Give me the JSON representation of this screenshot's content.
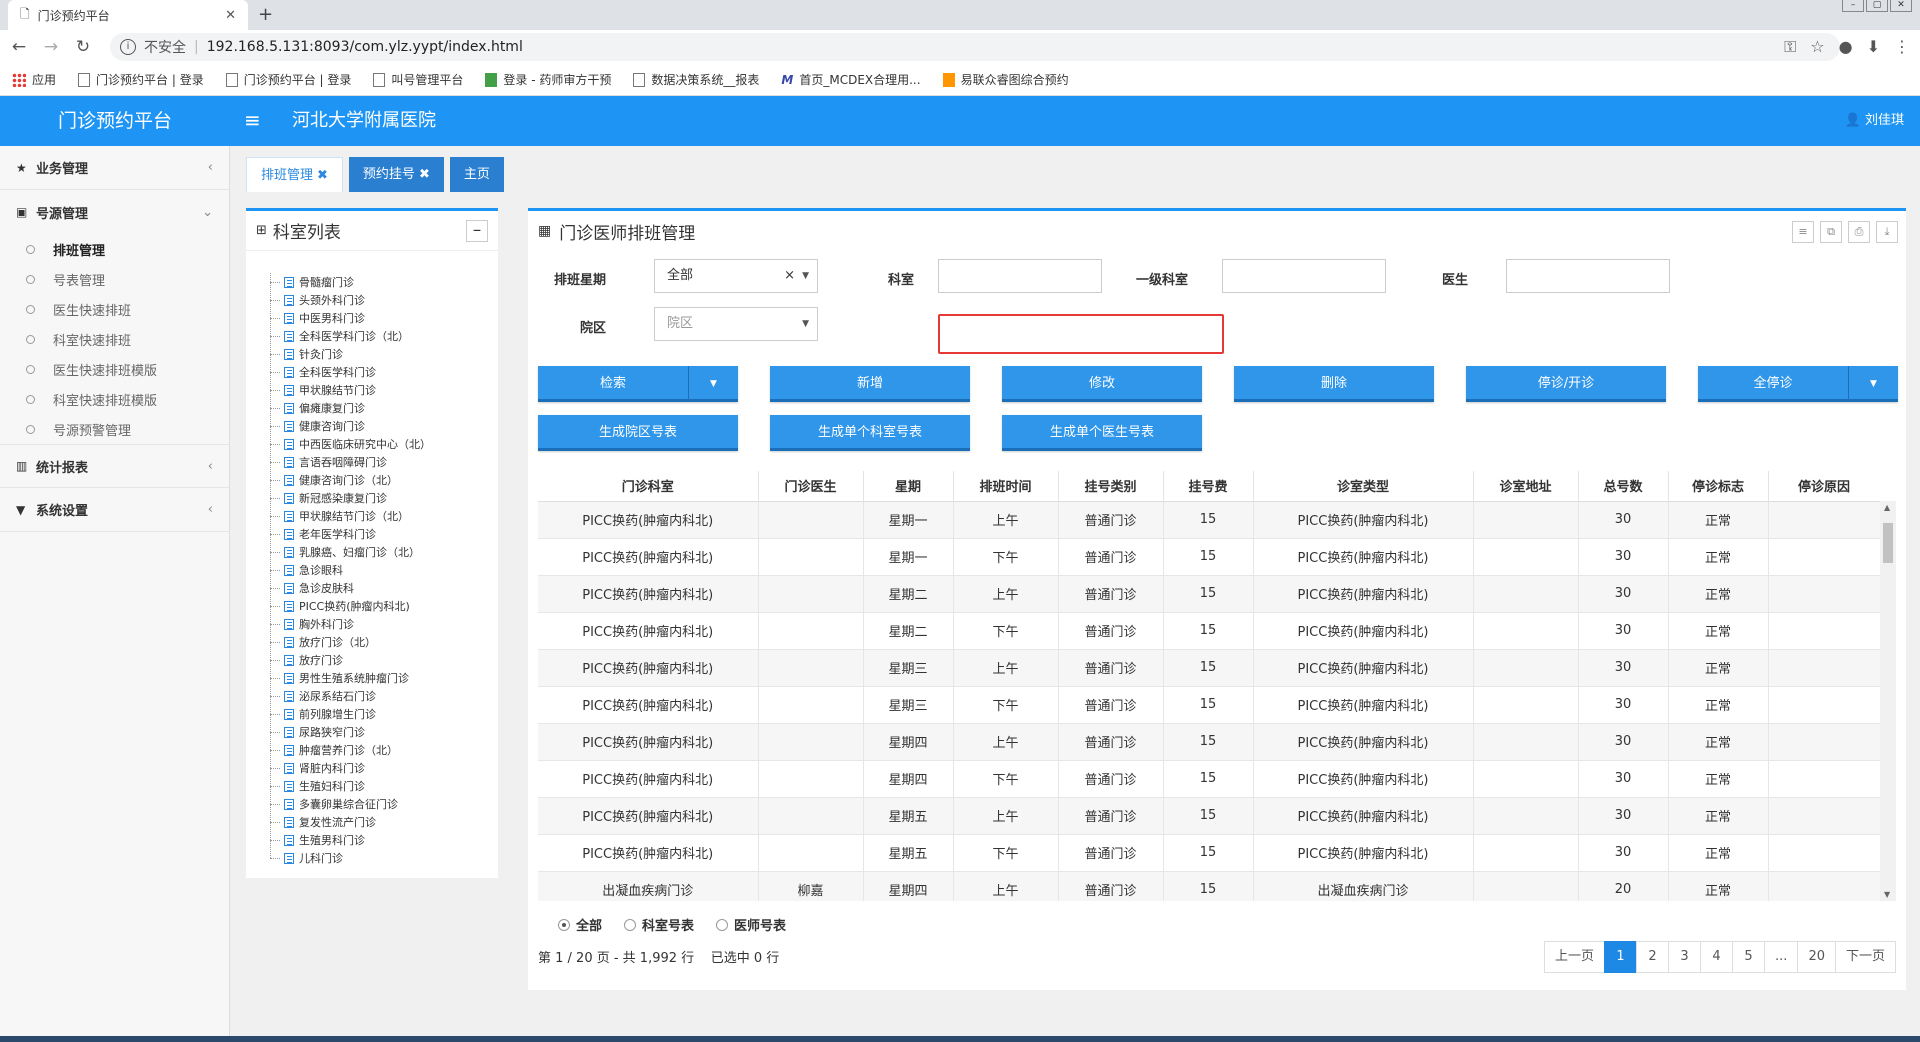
{
  "browser": {
    "tab_title": "门诊预约平台",
    "insecure_label": "不安全",
    "url": "192.168.5.131:8093/com.ylz.yypt/index.html",
    "bookmarks": [
      "应用",
      "门诊预约平台 | 登录",
      "门诊预约平台 | 登录",
      "叫号管理平台",
      "登录 - 药师审方干预",
      "数据决策系统__报表",
      "首页_MCDEX合理用...",
      "易联众睿图综合预约"
    ]
  },
  "header": {
    "brand": "门诊预约平台",
    "hospital": "河北大学附属医院",
    "user": "刘佳琪"
  },
  "sidebar": {
    "groups": [
      {
        "label": "业务管理"
      },
      {
        "label": "号源管理"
      },
      {
        "label": "统计报表"
      },
      {
        "label": "系统设置"
      }
    ],
    "sub_items": [
      "排班管理",
      "号表管理",
      "医生快速排班",
      "科室快速排班",
      "医生快速排班模版",
      "科室快速排班模版",
      "号源预警管理"
    ]
  },
  "page_tabs": [
    "排班管理",
    "预约挂号",
    "主页"
  ],
  "dept_panel": {
    "title": "科室列表",
    "items": [
      "骨髓瘤门诊",
      "头颈外科门诊",
      "中医男科门诊",
      "全科医学科门诊（北）",
      "针灸门诊",
      "全科医学科门诊",
      "甲状腺结节门诊",
      "偏瘫康复门诊",
      "健康咨询门诊",
      "中西医临床研究中心（北）",
      "言语吞咽障碍门诊",
      "健康咨询门诊（北）",
      "新冠感染康复门诊",
      "甲状腺结节门诊（北）",
      "老年医学科门诊",
      "乳腺癌、妇瘤门诊（北）",
      "急诊眼科",
      "急诊皮肤科",
      "PICC换药(肿瘤内科北)",
      "胸外科门诊",
      "放疗门诊（北）",
      "放疗门诊",
      "男性生殖系统肿瘤门诊",
      "泌尿系结石门诊",
      "前列腺增生门诊",
      "尿路狭窄门诊",
      "肿瘤营养门诊（北）",
      "肾脏内科门诊",
      "生殖妇科门诊",
      "多囊卵巢综合征门诊",
      "复发性流产门诊",
      "生殖男科门诊",
      "儿科门诊"
    ]
  },
  "main": {
    "title": "门诊医师排班管理",
    "form": {
      "week_label": "排班星期",
      "week_value": "全部",
      "dept_label": "科室",
      "dept_value": "",
      "first_dept_label": "一级科室",
      "first_dept_value": "",
      "doctor_label": "医生",
      "doctor_value": "",
      "campus_label": "院区",
      "campus_placeholder": "院区"
    },
    "buttons": {
      "search": "检索",
      "add": "新增",
      "edit": "修改",
      "delete": "删除",
      "stop_open": "停诊/开诊",
      "stop_all": "全停诊",
      "gen_campus": "生成院区号表",
      "gen_dept": "生成单个科室号表",
      "gen_doctor": "生成单个医生号表"
    },
    "table": {
      "columns": [
        "门诊科室",
        "门诊医生",
        "星期",
        "排班时间",
        "挂号类别",
        "挂号费",
        "诊室类型",
        "诊室地址",
        "总号数",
        "停诊标志",
        "停诊原因"
      ],
      "rows": [
        [
          "PICC换药(肿瘤内科北)",
          "",
          "星期一",
          "上午",
          "普通门诊",
          "15",
          "PICC换药(肿瘤内科北)",
          "",
          "30",
          "正常",
          ""
        ],
        [
          "PICC换药(肿瘤内科北)",
          "",
          "星期一",
          "下午",
          "普通门诊",
          "15",
          "PICC换药(肿瘤内科北)",
          "",
          "30",
          "正常",
          ""
        ],
        [
          "PICC换药(肿瘤内科北)",
          "",
          "星期二",
          "上午",
          "普通门诊",
          "15",
          "PICC换药(肿瘤内科北)",
          "",
          "30",
          "正常",
          ""
        ],
        [
          "PICC换药(肿瘤内科北)",
          "",
          "星期二",
          "下午",
          "普通门诊",
          "15",
          "PICC换药(肿瘤内科北)",
          "",
          "30",
          "正常",
          ""
        ],
        [
          "PICC换药(肿瘤内科北)",
          "",
          "星期三",
          "上午",
          "普通门诊",
          "15",
          "PICC换药(肿瘤内科北)",
          "",
          "30",
          "正常",
          ""
        ],
        [
          "PICC换药(肿瘤内科北)",
          "",
          "星期三",
          "下午",
          "普通门诊",
          "15",
          "PICC换药(肿瘤内科北)",
          "",
          "30",
          "正常",
          ""
        ],
        [
          "PICC换药(肿瘤内科北)",
          "",
          "星期四",
          "上午",
          "普通门诊",
          "15",
          "PICC换药(肿瘤内科北)",
          "",
          "30",
          "正常",
          ""
        ],
        [
          "PICC换药(肿瘤内科北)",
          "",
          "星期四",
          "下午",
          "普通门诊",
          "15",
          "PICC换药(肿瘤内科北)",
          "",
          "30",
          "正常",
          ""
        ],
        [
          "PICC换药(肿瘤内科北)",
          "",
          "星期五",
          "上午",
          "普通门诊",
          "15",
          "PICC换药(肿瘤内科北)",
          "",
          "30",
          "正常",
          ""
        ],
        [
          "PICC换药(肿瘤内科北)",
          "",
          "星期五",
          "下午",
          "普通门诊",
          "15",
          "PICC换药(肿瘤内科北)",
          "",
          "30",
          "正常",
          ""
        ],
        [
          "出凝血疾病门诊",
          "柳嘉",
          "星期四",
          "上午",
          "普通门诊",
          "15",
          "出凝血疾病门诊",
          "",
          "20",
          "正常",
          ""
        ]
      ]
    },
    "radios": [
      "全部",
      "科室号表",
      "医师号表"
    ],
    "pager_info": "第 1 / 20 页 - 共 1,992 行    已选中 0 行",
    "pager": [
      "上一页",
      "1",
      "2",
      "3",
      "4",
      "5",
      "...",
      "20",
      "下一页"
    ]
  }
}
